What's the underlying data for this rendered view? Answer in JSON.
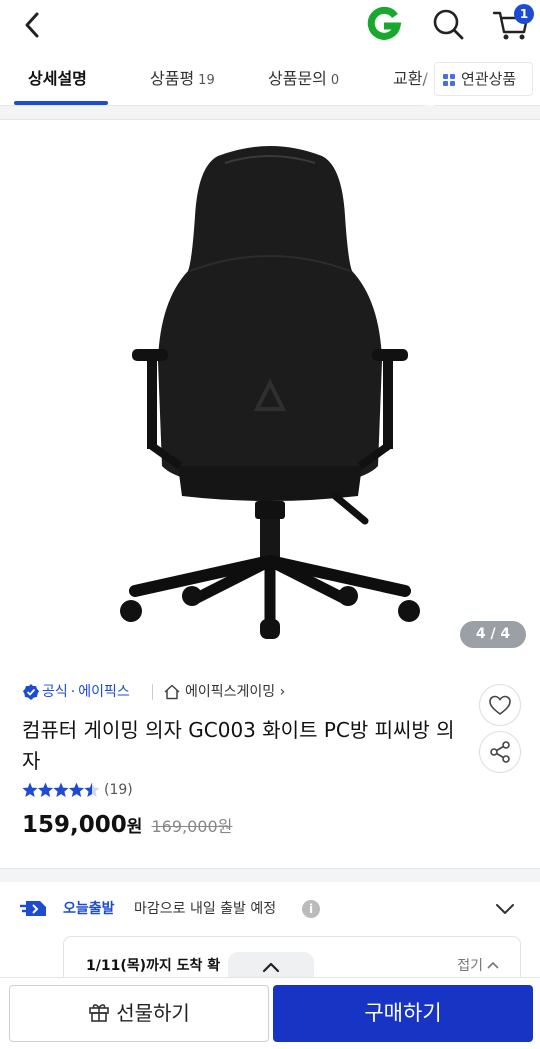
{
  "header": {
    "cart_count": "1",
    "icons": [
      "back-arrow-icon",
      "gmarket-g-logo",
      "search-icon",
      "cart-icon"
    ],
    "logo_color": "#18a82d",
    "accent": "#1d4bd3"
  },
  "tabs": [
    {
      "label": "상세설명",
      "count": ""
    },
    {
      "label": "상품평",
      "count": "19"
    },
    {
      "label": "상품문의",
      "count": "0"
    },
    {
      "label": "교환/",
      "count": ""
    }
  ],
  "related_label": "연관상품",
  "image": {
    "counter": "4 / 4"
  },
  "product": {
    "brand_label": "공식",
    "brand_sep": "·",
    "brand_name": "에이픽스",
    "store_name": "에이픽스게이밍",
    "store_chevron": "›",
    "title": "컴퓨터 게이밍 의자 GC003 화이트 PC방 피씨방 의자",
    "rating": 4.5,
    "review_count": "(19)",
    "price": "159,000",
    "price_unit": "원",
    "original_price": "169,000원"
  },
  "delivery": {
    "label": "오늘출발",
    "text": "마감으로 내일 출발 예정",
    "info_icon": "i",
    "arrival": "1/11(목)까지 도착 확",
    "fold_label": "접기"
  },
  "bottom": {
    "gift_label": "선물하기",
    "buy_label": "구매하기",
    "buy_color": "#1734c4"
  }
}
